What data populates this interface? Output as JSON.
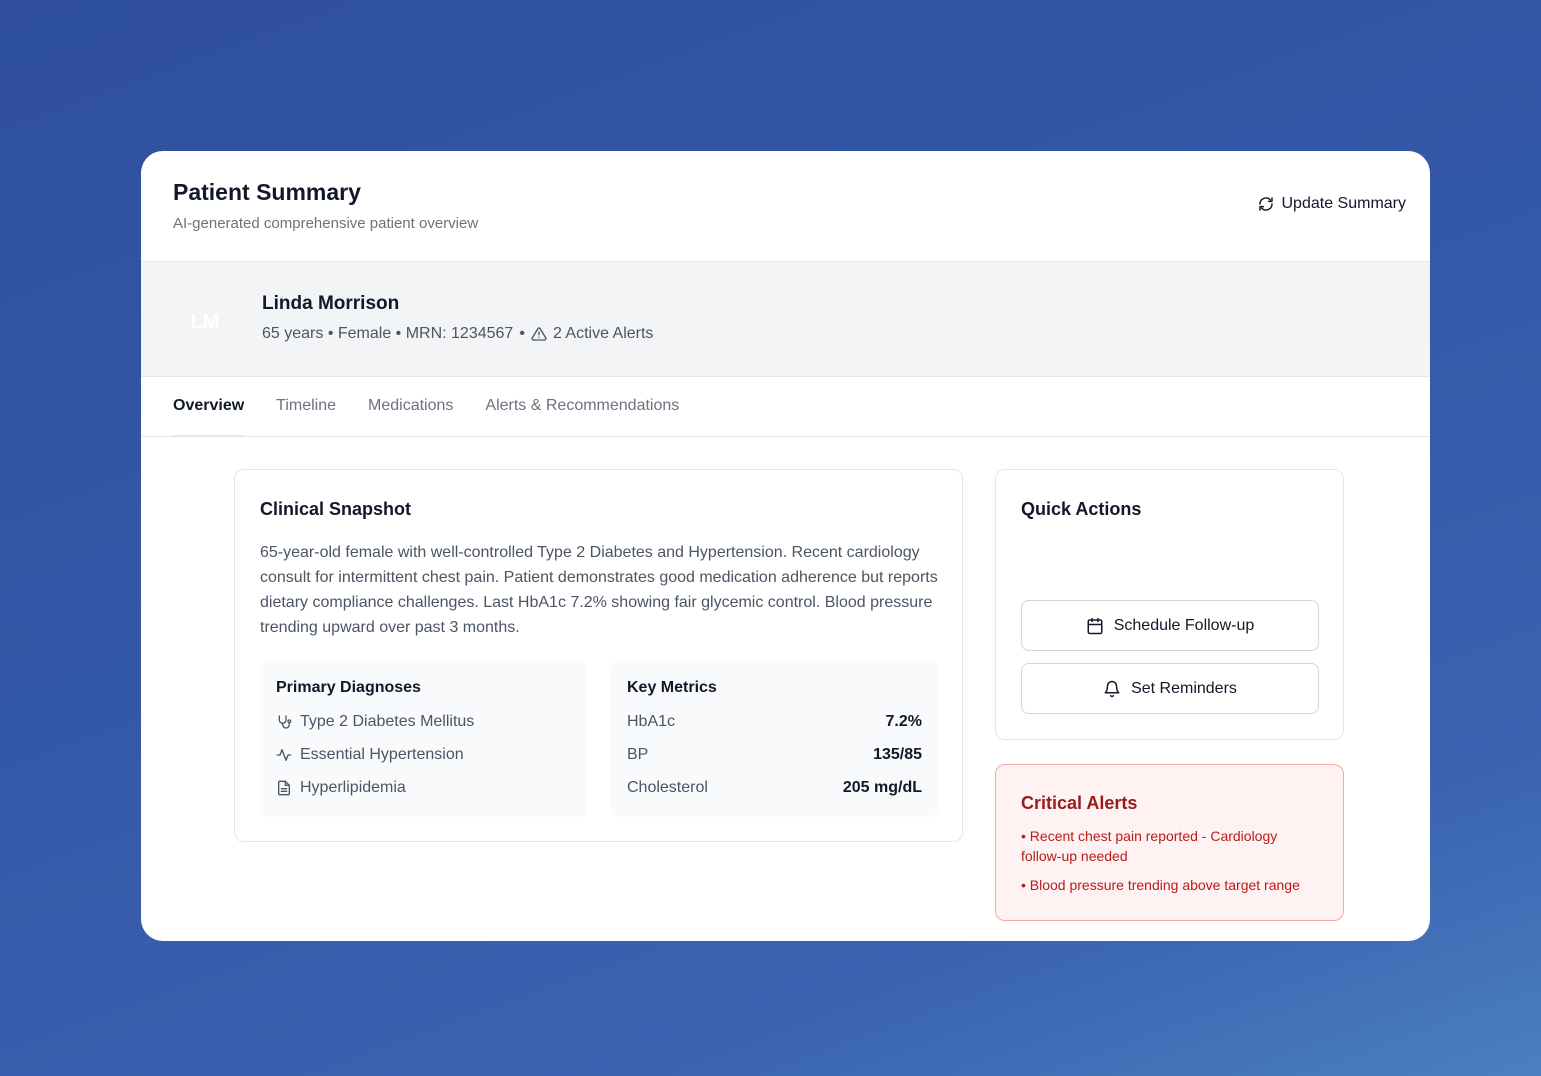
{
  "header": {
    "title": "Patient Summary",
    "subtitle": "AI-generated comprehensive patient overview",
    "update_label": "Update Summary"
  },
  "patient": {
    "initials": "LM",
    "name": "Linda Morrison",
    "meta": "65 years • Female • MRN: 1234567",
    "separator": "•",
    "alerts_label": "2 Active Alerts"
  },
  "tabs": [
    {
      "label": "Overview"
    },
    {
      "label": "Timeline"
    },
    {
      "label": "Medications"
    },
    {
      "label": "Alerts & Recommendations"
    }
  ],
  "snapshot": {
    "title": "Clinical Snapshot",
    "text": "65-year-old female with well-controlled Type 2 Diabetes and Hypertension. Recent cardiology consult for intermittent chest pain. Patient demonstrates good medication adherence but reports dietary compliance challenges. Last HbA1c 7.2% showing fair glycemic control. Blood pressure trending upward over past 3 months.",
    "diagnoses_title": "Primary Diagnoses",
    "diagnoses": [
      {
        "label": "Type 2 Diabetes Mellitus",
        "icon": "stethoscope-icon"
      },
      {
        "label": "Essential Hypertension",
        "icon": "activity-icon"
      },
      {
        "label": "Hyperlipidemia",
        "icon": "document-icon"
      }
    ],
    "metrics_title": "Key Metrics",
    "metrics": [
      {
        "label": "HbA1c",
        "value": "7.2%"
      },
      {
        "label": "BP",
        "value": "135/85"
      },
      {
        "label": "Cholesterol",
        "value": "205 mg/dL"
      }
    ]
  },
  "quick_actions": {
    "title": "Quick Actions",
    "schedule_label": "Schedule Follow-up",
    "reminders_label": "Set Reminders"
  },
  "critical_alerts": {
    "title": "Critical Alerts",
    "items": [
      "• Recent chest pain reported - Cardiology follow-up needed",
      "• Blood pressure trending above target range"
    ]
  },
  "colors": {
    "alert_text": "#b91c1c",
    "alert_bg": "#fef2f2",
    "alert_border": "#fca5a5"
  }
}
